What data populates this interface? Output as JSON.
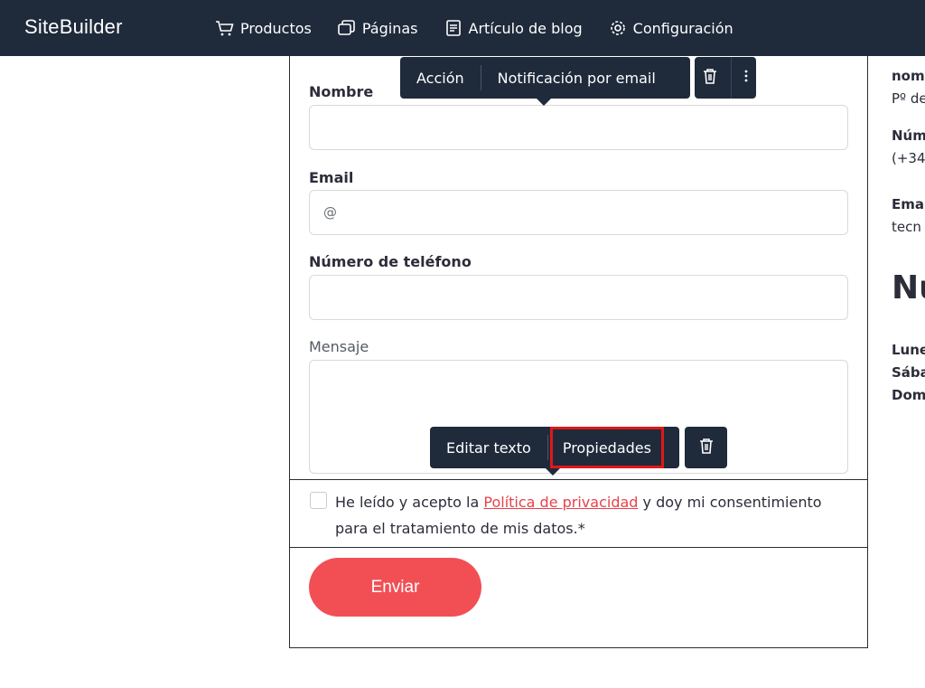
{
  "app": {
    "brand": "SiteBuilder"
  },
  "nav": {
    "items": [
      {
        "label": "Productos",
        "icon": "cart-icon"
      },
      {
        "label": "Páginas",
        "icon": "pages-icon"
      },
      {
        "label": "Artículo de blog",
        "icon": "blog-icon"
      },
      {
        "label": "Configuración",
        "icon": "gear-icon"
      }
    ]
  },
  "form": {
    "name_label": "Nombre",
    "name_value": "",
    "email_label": "Email",
    "email_placeholder": "@",
    "phone_label": "Número de teléfono",
    "phone_value": "",
    "message_label": "Mensaje",
    "message_value": "",
    "consent_prefix": "He leído y acepto la ",
    "consent_link": "Política de privacidad",
    "consent_suffix": " y doy mi consenti­miento para el tratamiento de mis datos.*",
    "submit_label": "Enviar"
  },
  "toolbar_top": {
    "action_label": "Acción",
    "email_notify_label": "Notificación por email",
    "delete_icon": "trash-icon",
    "more_icon": "kebab-icon"
  },
  "toolbar_text": {
    "edit_label": "Editar texto",
    "properties_label": "Propiedades",
    "delete_icon": "trash-icon"
  },
  "sidebar": {
    "l1": "nom",
    "l2": "Pº de",
    "l3": "Núm",
    "l4": "(+34",
    "l5": "Ema",
    "l6": "tecn",
    "heading": "Nu",
    "l7": "Lune",
    "l8": "Sába",
    "l9": "Dom"
  },
  "colors": {
    "nav_bg": "#1f2a3b",
    "accent": "#f24f55",
    "link": "#e9414a",
    "highlight": "#e01818"
  }
}
